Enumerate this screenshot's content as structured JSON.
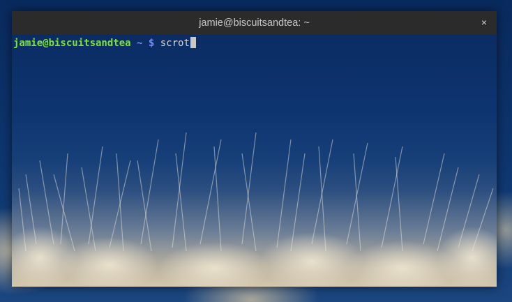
{
  "window": {
    "title": "jamie@biscuitsandtea: ~",
    "close_glyph": "×"
  },
  "terminal": {
    "prompt_user_host": "jamie@biscuitsandtea",
    "prompt_path": "~ $",
    "command": "scrot"
  },
  "colors": {
    "prompt_user": "#7ee23b",
    "prompt_path": "#7a8cff",
    "titlebar": "#2b2b2b",
    "sky": "#0e3470"
  },
  "icons": {
    "close": "close-icon",
    "cursor": "block-cursor"
  }
}
